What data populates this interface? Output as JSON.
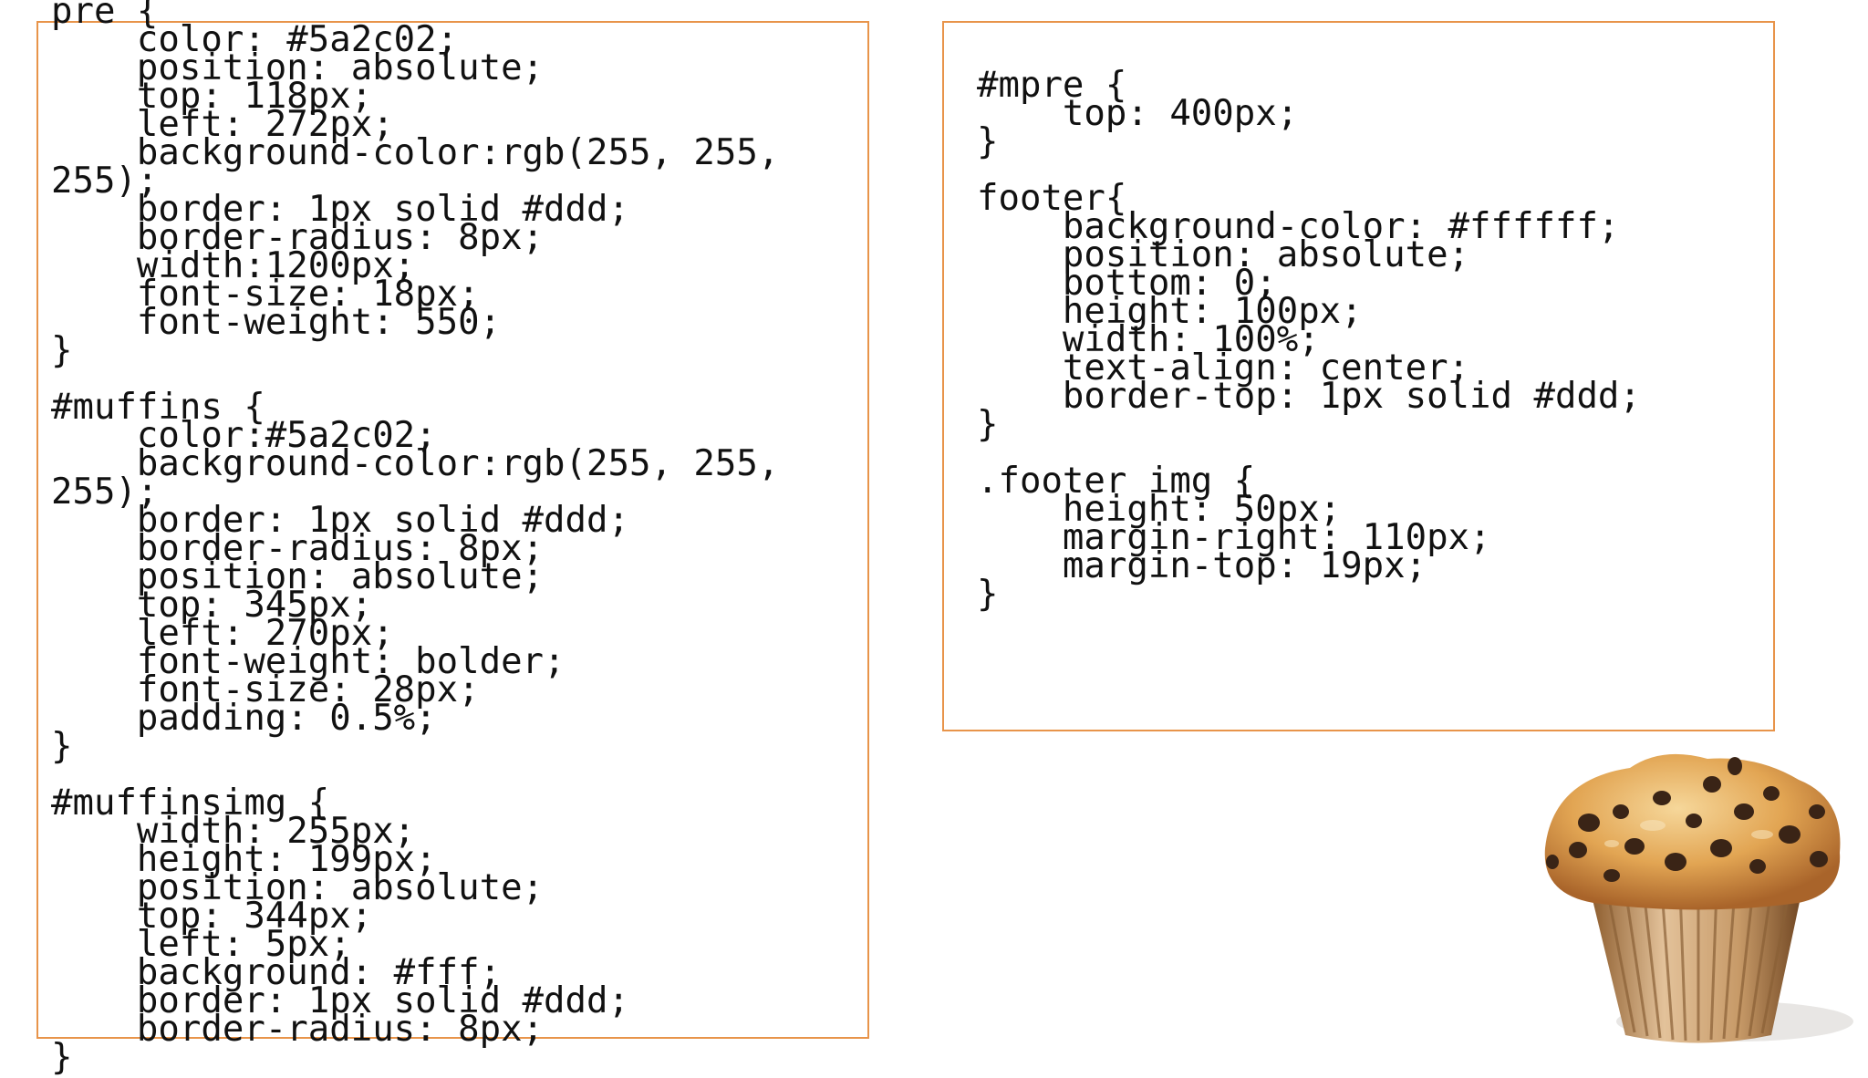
{
  "left_panel": {
    "code": "pre {\n    color: #5a2c02;\n    position: absolute;\n    top: 118px;\n    left: 272px;\n    background-color:rgb(255, 255,\n255);\n    border: 1px solid #ddd;\n    border-radius: 8px;\n    width:1200px;\n    font-size: 18px;\n    font-weight: 550;\n}\n\n#muffins {\n    color:#5a2c02;\n    background-color:rgb(255, 255,\n255);\n    border: 1px solid #ddd;\n    border-radius: 8px;\n    position: absolute;\n    top: 345px;\n    left: 270px;\n    font-weight: bolder;\n    font-size: 28px;\n    padding: 0.5%;\n}\n\n#muffinsimg {\n    width: 255px;\n    height: 199px;\n    position: absolute;\n    top: 344px;\n    left: 5px;\n    background: #fff;\n    border: 1px solid #ddd;\n    border-radius: 8px;\n}"
  },
  "right_panel": {
    "code": "#mpre {\n    top: 400px;\n}\n\nfooter{\n    background-color: #ffffff;\n    position: absolute;\n    bottom: 0;\n    height: 100px;\n    width: 100%;\n    text-align: center;\n    border-top: 1px solid #ddd;\n}\n\n.footer img {\n    height: 50px;\n    margin-right: 110px;\n    margin-top: 19px;\n}"
  },
  "colors": {
    "box_border": "#e8944a",
    "muffin_crust": "#d89a45",
    "muffin_wrapper": "#b8793d",
    "chocolate_chip": "#3a2416"
  },
  "image": {
    "icon": "muffin-illustration"
  }
}
